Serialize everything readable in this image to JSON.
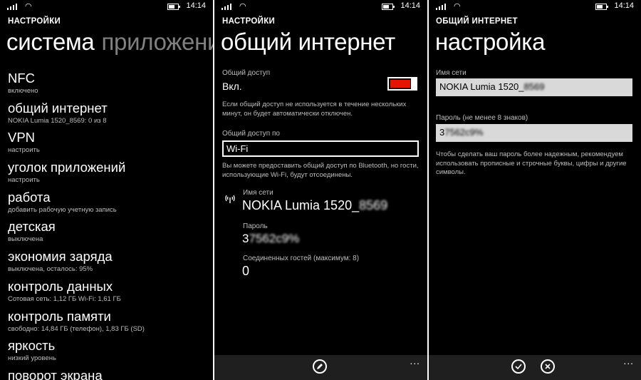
{
  "status": {
    "time": "14:14"
  },
  "screen1": {
    "app_title": "НАСТРОЙКИ",
    "pivot_current": "система",
    "pivot_next": "приложения",
    "items": [
      {
        "title": "NFC",
        "subtitle": "включено"
      },
      {
        "title": "общий интернет",
        "subtitle": "NOKIA Lumia 1520_8569: 0 из 8"
      },
      {
        "title": "VPN",
        "subtitle": "настроить"
      },
      {
        "title": "уголок приложений",
        "subtitle": "настроить"
      },
      {
        "title": "работа",
        "subtitle": "добавить рабочую учетную запись"
      },
      {
        "title": "детская",
        "subtitle": "выключена"
      },
      {
        "title": "экономия заряда",
        "subtitle": "выключена, осталось: 95%"
      },
      {
        "title": "контроль данных",
        "subtitle": "Сотовая сеть: 1,12 ГБ Wi-Fi: 1,61 ГБ"
      },
      {
        "title": "контроль памяти",
        "subtitle": "свободно: 14,84 ГБ (телефон), 1,83 ГБ (SD)"
      },
      {
        "title": "яркость",
        "subtitle": "низкий уровень"
      },
      {
        "title": "поворот экрана",
        "subtitle": ""
      }
    ]
  },
  "screen2": {
    "app_title": "НАСТРОЙКИ",
    "page_title": "общий интернет",
    "sharing_label": "Общий доступ",
    "sharing_value": "Вкл.",
    "sharing_help": "Если общий доступ не используется в течение нескольких минут, он будет автоматически отключен.",
    "share_over_label": "Общий доступ по",
    "share_over_value": "Wi-Fi",
    "share_over_help": "Вы можете предоставить общий доступ по Bluetooth, но гости, использующие Wi-Fi, будут отсоединены.",
    "network_name_label": "Имя сети",
    "network_name_value": "NOKIA Lumia 1520_",
    "network_name_hidden": "8569",
    "password_label": "Пароль",
    "password_value": "3",
    "password_hidden": "7562c9%",
    "guests_label": "Соединенных гостей (максимум: 8)",
    "guests_value": "0",
    "more_label": "..."
  },
  "screen3": {
    "app_title": "ОБЩИЙ ИНТЕРНЕТ",
    "page_title": "настройка",
    "network_name_label": "Имя сети",
    "network_name_value": "NOKIA Lumia 1520_",
    "network_name_hidden": "8569",
    "password_label": "Пароль (не менее 8 знаков)",
    "password_value": "3",
    "password_hidden": "7562c9%",
    "help": "Чтобы сделать ваш пароль более надежным, рекомендуем использовать прописные и строчные буквы, цифры и другие символы.",
    "more_label": "..."
  },
  "colors": {
    "accent": "#e51400",
    "background": "#000000",
    "appbar": "#1f1f1f",
    "textbox": "#d9d9d9"
  }
}
